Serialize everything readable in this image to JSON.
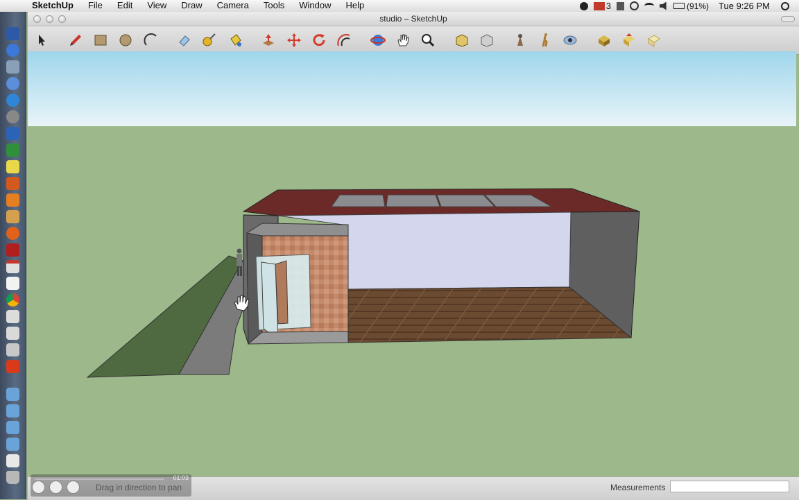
{
  "menubar": {
    "app_name": "SketchUp",
    "menus": [
      "File",
      "Edit",
      "View",
      "Draw",
      "Camera",
      "Tools",
      "Window",
      "Help"
    ],
    "battery": "(91%)",
    "mail_count": "3",
    "clock": "Tue 9:26 PM"
  },
  "window": {
    "title": "studio – SketchUp"
  },
  "toolbar": {
    "tools": [
      "select-tool",
      "pencil-tool",
      "rectangle-tool",
      "circle-tool",
      "arc-tool",
      "eraser-tool",
      "tape-measure-tool",
      "paint-bucket-tool",
      "push-pull-tool",
      "move-tool",
      "rotate-tool",
      "offset-tool",
      "orbit-tool",
      "pan-tool",
      "zoom-tool",
      "zoom-extents-tool",
      "previous-view-tool",
      "position-camera-tool",
      "walk-tool",
      "look-around-tool",
      "get-models-tool",
      "share-model-tool",
      "components-tool"
    ]
  },
  "statusbar": {
    "status_text": "Drag in direction to pan",
    "measurements_label": "Measurements",
    "measurements_value": "",
    "video_time": "01:03"
  },
  "colors": {
    "sky_top": "#9fd6ec",
    "ground": "#9db98b",
    "roof": "#6b2a27",
    "wall_interior": "#d4d6ee",
    "floor": "#6a4a31"
  }
}
